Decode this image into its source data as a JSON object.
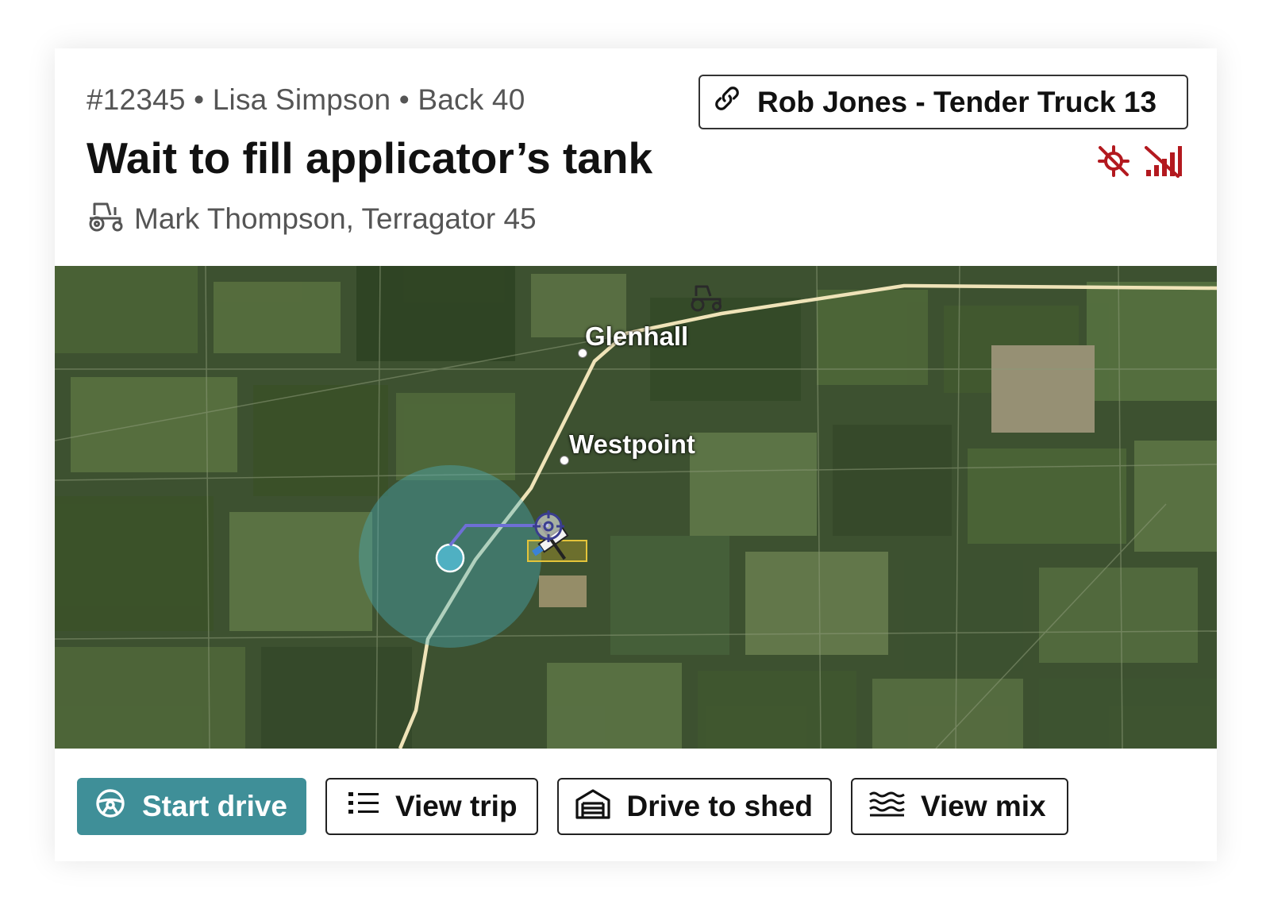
{
  "header": {
    "meta": "#12345 • Lisa Simpson • Back 40",
    "title": "Wait to fill applicator’s tank",
    "operator": "Mark Thompson, Terragator 45",
    "linked_vehicle": "Rob Jones - Tender Truck 13"
  },
  "status": {
    "color": "#b3191f",
    "icons": [
      "gps-off-icon",
      "signal-off-icon"
    ]
  },
  "map": {
    "places": [
      "Glenhall",
      "Westpoint"
    ]
  },
  "actions": {
    "start_drive": "Start drive",
    "view_trip": "View trip",
    "drive_to_shed": "Drive to shed",
    "view_mix": "View mix"
  },
  "colors": {
    "accent": "#3f8f98",
    "road": "#efe3b8",
    "route": "#6e6fd6"
  }
}
